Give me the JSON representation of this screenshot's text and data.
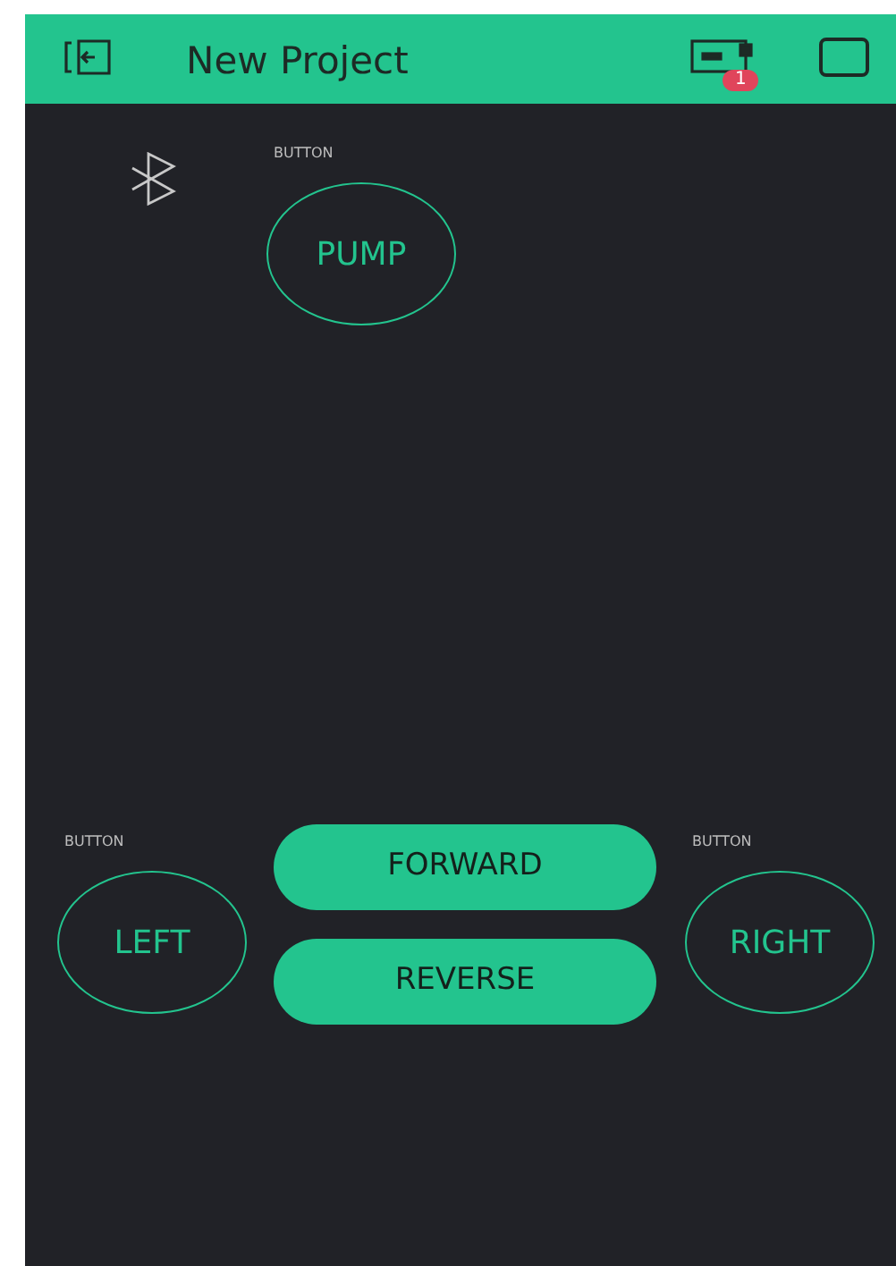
{
  "header": {
    "title": "New Project",
    "device_badge": "1"
  },
  "widgets": [
    {
      "kind": "outline",
      "caption": "BUTTON",
      "label": "PUMP"
    },
    {
      "kind": "outline",
      "caption": "BUTTON",
      "label": "LEFT"
    },
    {
      "kind": "filled",
      "label": "FORWARD"
    },
    {
      "kind": "filled",
      "label": "REVERSE"
    },
    {
      "kind": "outline",
      "caption": "BUTTON",
      "label": "RIGHT"
    }
  ]
}
